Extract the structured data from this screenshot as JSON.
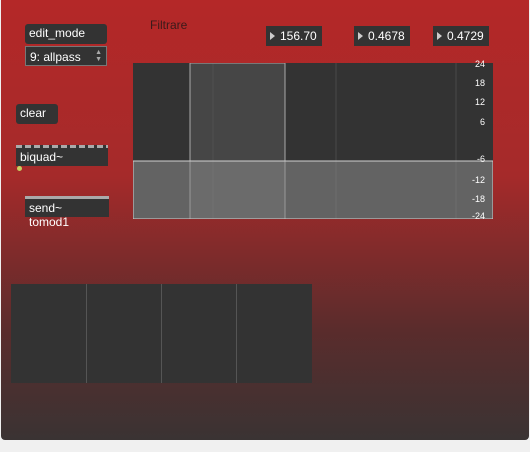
{
  "patch": {
    "edit_mode_label": "edit_mode",
    "filter_type": "9: allpass",
    "clear_label": "clear",
    "biquad_label": "biquad~",
    "send_label": "send~ tomod1",
    "title_label": "Filtrare"
  },
  "numbers": {
    "freq": "156.70",
    "gain": "0.4678",
    "q": "0.4729"
  },
  "filtergraph": {
    "db_ticks": [
      "24",
      "18",
      "12",
      "6",
      "-6",
      "-12",
      "-18",
      "-24"
    ]
  },
  "multislider": {
    "columns": 4
  },
  "colors": {
    "panel_top": "#b42828",
    "panel_bottom": "#3a3333",
    "object_bg": "#333333"
  }
}
